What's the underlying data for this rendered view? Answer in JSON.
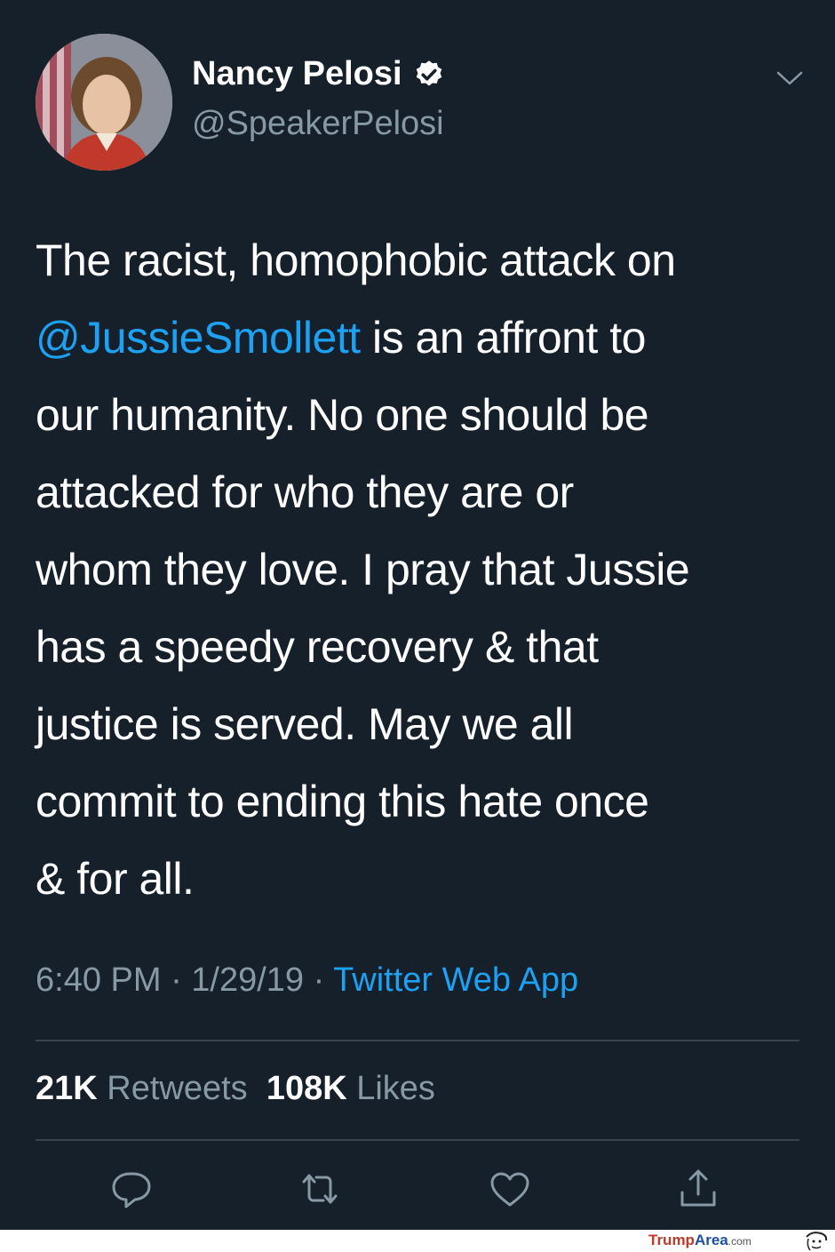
{
  "tweet": {
    "author": {
      "display_name": "Nancy Pelosi",
      "handle": "@SpeakerPelosi",
      "verified": true
    },
    "text_lines": [
      "The racist, homophobic attack on",
      "is an affront to",
      "our humanity. No one should be",
      "attacked for who they are or",
      "whom they love. I pray that Jussie",
      "has a speedy recovery & that",
      "justice is served. May we all",
      "commit to ending this hate once",
      "& for all."
    ],
    "mention": "@JussieSmollett",
    "timestamp": "6:40 PM · 1/29/19 · ",
    "source": "Twitter Web App",
    "retweets_count": "21K",
    "retweets_label": "Retweets",
    "likes_count": "108K",
    "likes_label": "Likes",
    "actions": [
      "reply-icon",
      "retweet-icon",
      "like-icon",
      "share-icon"
    ]
  },
  "watermark": {
    "part1": "Trump",
    "part2": "Area",
    "part3": ".com"
  },
  "colors": {
    "background": "#15202b",
    "text": "#ffffff",
    "secondary": "#8899a6",
    "link": "#1da1f2",
    "divider": "#38444d"
  }
}
